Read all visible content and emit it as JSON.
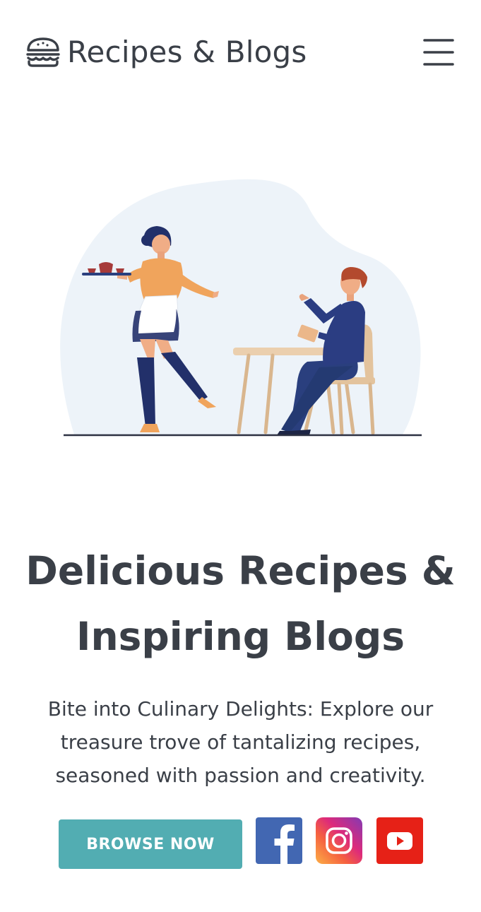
{
  "header": {
    "brand": "Recipes & Blogs",
    "logo_icon": "burger-icon",
    "menu_icon": "hamburger-menu-icon"
  },
  "hero": {
    "illustration": "waitress-serving-seated-customer-illustration",
    "headline_line1": "Delicious Recipes &",
    "headline_line2": "Inspiring Blogs",
    "subtitle_line1": "Bite into Culinary Delights: Explore our",
    "subtitle_line2": "treasure trove of tantalizing recipes,",
    "subtitle_line3": "seasoned with passion and creativity.",
    "cta_label": "BROWSE NOW"
  },
  "social": [
    {
      "icon": "facebook-icon",
      "color": "#4267b2"
    },
    {
      "icon": "instagram-icon",
      "color": "#dd2a7b"
    },
    {
      "icon": "youtube-icon",
      "color": "#e62117"
    }
  ],
  "colors": {
    "text": "#3a3f47",
    "accent": "#52adb2",
    "illustration_bg": "#edf3f9"
  }
}
